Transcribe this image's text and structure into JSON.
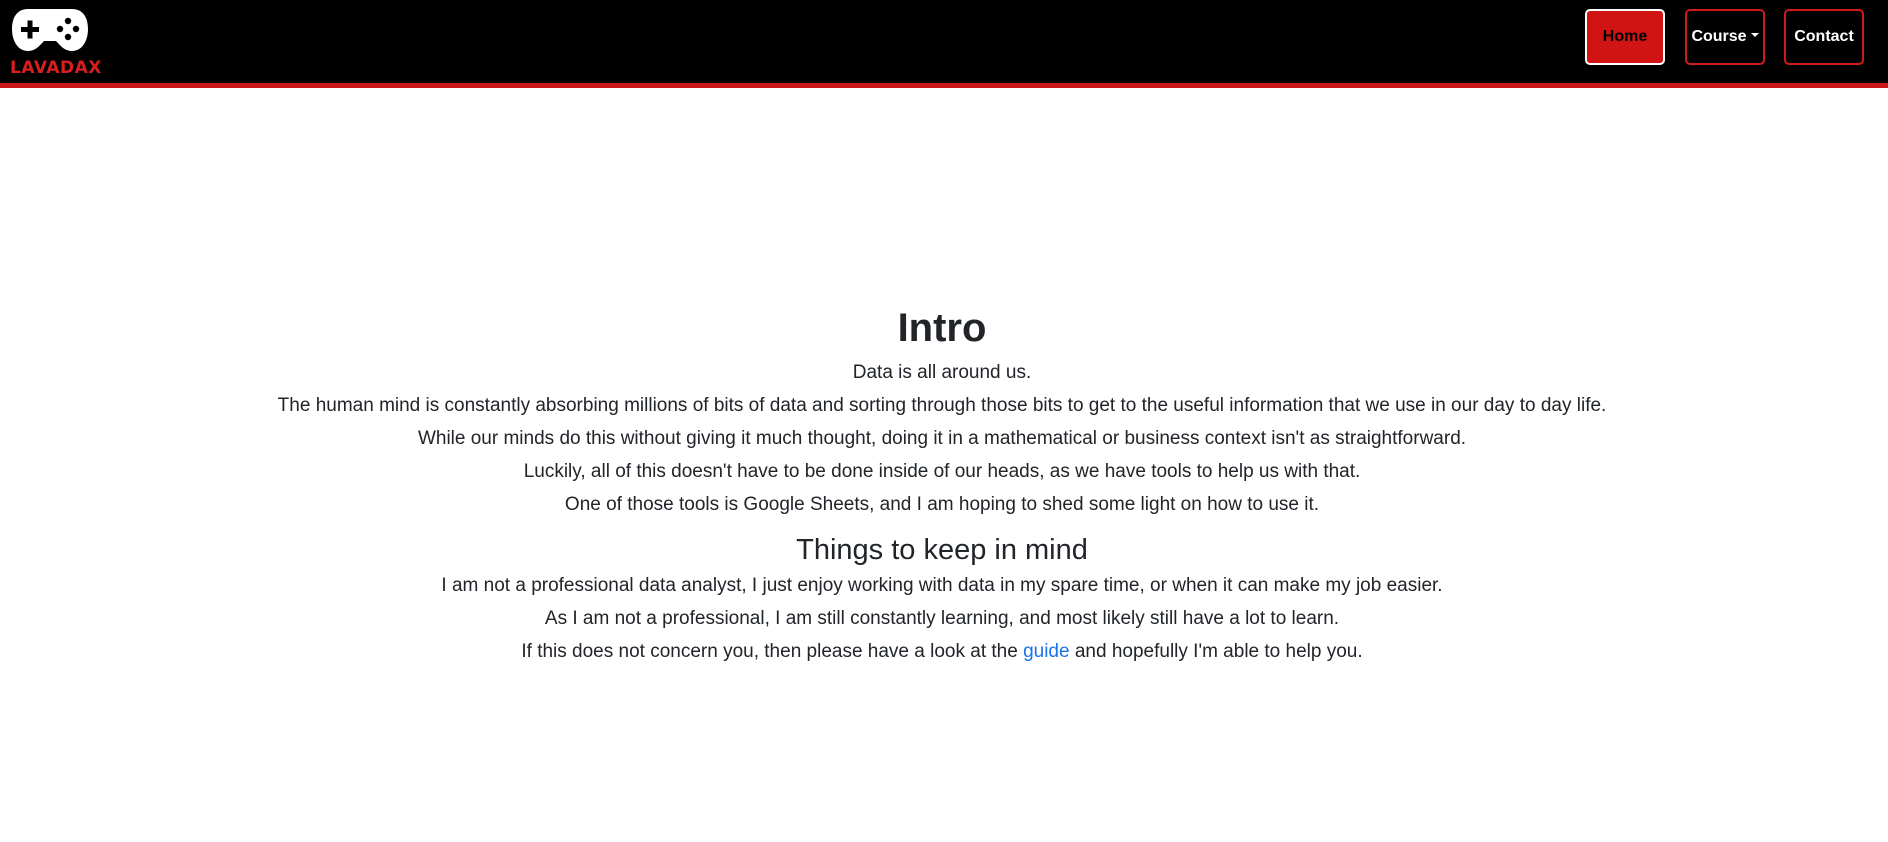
{
  "nav": {
    "brand_text": "LAVADAX",
    "items": [
      {
        "label": "Home",
        "active": true
      },
      {
        "label": "Course",
        "dropdown": true
      },
      {
        "label": "Contact"
      }
    ]
  },
  "main": {
    "intro_title": "Intro",
    "intro_paragraphs": [
      "Data is all around us.",
      "The human mind is constantly absorbing millions of bits of data and sorting through those bits to get to the useful information that we use in our day to day life.",
      "While our minds do this without giving it much thought, doing it in a mathematical or business context isn't as straightforward.",
      "Luckily, all of this doesn't have to be done inside of our heads, as we have tools to help us with that.",
      "One of those tools is Google Sheets, and I am hoping to shed some light on how to use it."
    ],
    "keep_title": "Things to keep in mind",
    "keep_paragraphs": [
      "I am not a professional data analyst, I just enjoy working with data in my spare time, or when it can make my job easier.",
      "As I am not a professional, I am still constantly learning, and most likely still have a lot to learn."
    ],
    "last_line": {
      "before": "If this does not concern you, then please have a look at the ",
      "link": "guide",
      "after": " and hopefully I'm able to help you."
    }
  },
  "colors": {
    "accent": "#cc1717",
    "nav_bg": "#000000",
    "link": "#1a73e8"
  },
  "icons": {
    "logo": "gamepad-icon"
  }
}
